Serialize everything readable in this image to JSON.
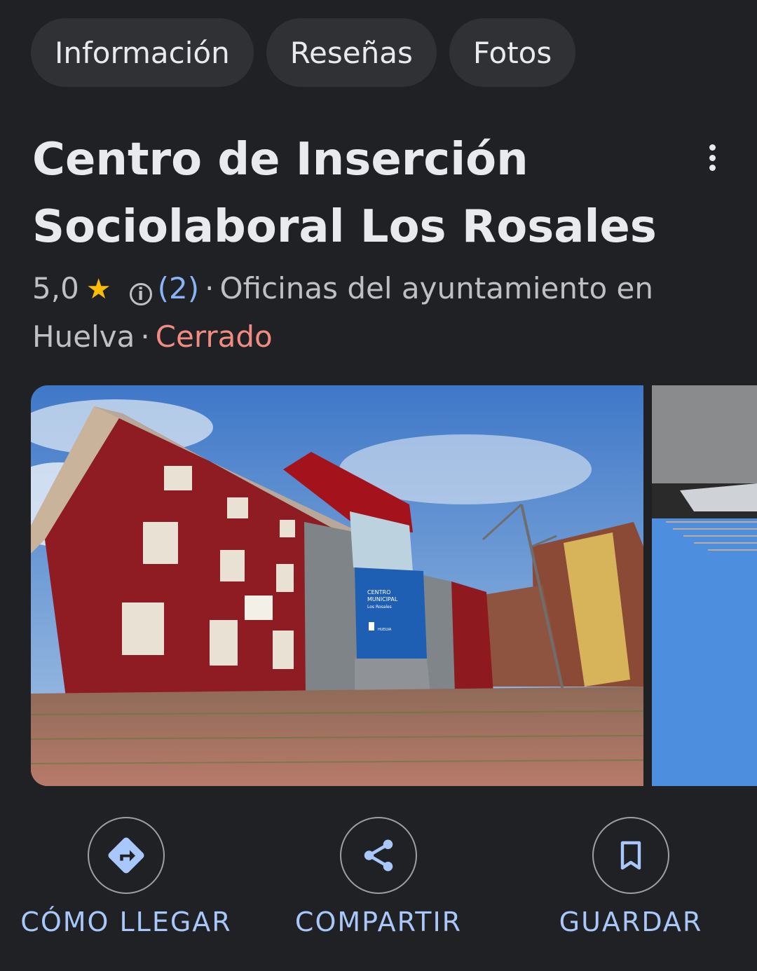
{
  "tabs": [
    {
      "label": "Información"
    },
    {
      "label": "Reseñas"
    },
    {
      "label": "Fotos"
    }
  ],
  "place": {
    "name": "Centro de Inserción Sociolaboral Los Rosales",
    "rating": "5,0",
    "review_count": "(2)",
    "category": "Oficinas del ayuntamiento en Huelva",
    "status": "Cerrado"
  },
  "photo": {
    "sign_line1": "CENTRO",
    "sign_line2": "MUNICIPAL",
    "sign_line3": "Los Rosales",
    "sign_line4": "HUELVA"
  },
  "actions": [
    {
      "label": "CÓMO LLEGAR",
      "icon": "directions-icon"
    },
    {
      "label": "COMPARTIR",
      "icon": "share-icon"
    },
    {
      "label": "GUARDAR",
      "icon": "bookmark-icon"
    }
  ],
  "colors": {
    "background": "#202124",
    "accent": "#a8c7fa",
    "link": "#8ab4f8",
    "closed": "#f28b82",
    "star": "#fbbc04"
  }
}
